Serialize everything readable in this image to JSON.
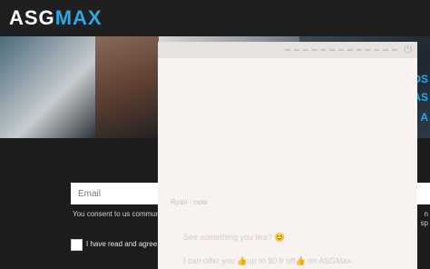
{
  "logo": {
    "part1": "ASG",
    "part2": "MAX"
  },
  "banner": {
    "side_text": [
      "OS",
      "AS",
      "A"
    ]
  },
  "form": {
    "email_placeholder": "Email",
    "consent_text": "You consent to us communi",
    "agree_text": "I have read and agree t",
    "right_edge": [
      "n",
      "sp"
    ]
  },
  "chat": {
    "close_icon": "⏻",
    "agent_label": "Ryan · now",
    "message_1": "See something you like? 😊",
    "message_2": "I can offer you 👍up to $0 fr off👍 on ASGMax"
  },
  "colors": {
    "brand": "#2ea7e0",
    "background": "#1c1c1c",
    "chat_bg": "#f8f3f0"
  }
}
